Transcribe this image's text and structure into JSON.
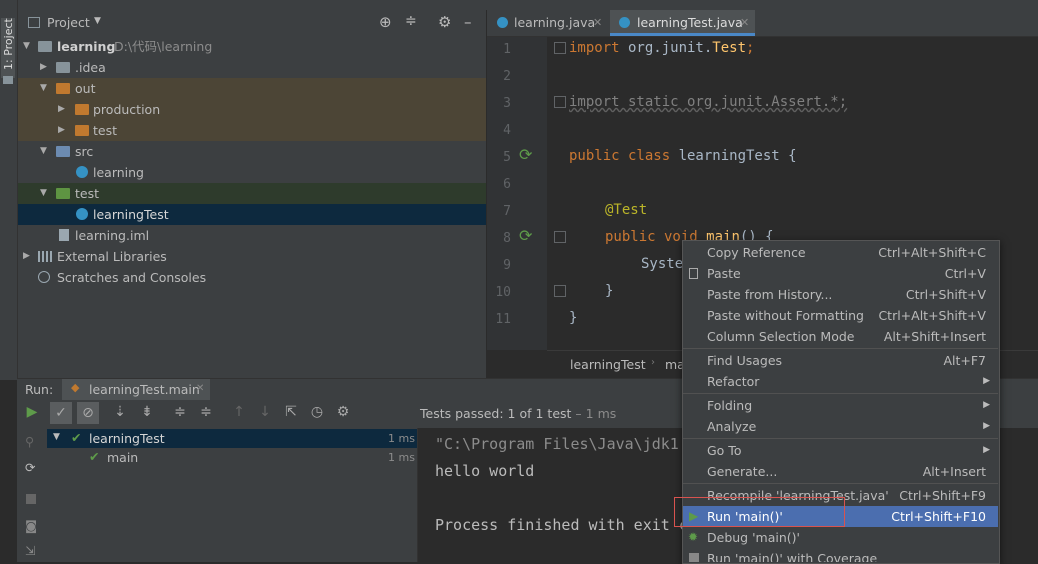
{
  "left_strip": {
    "label": "1: Project"
  },
  "project": {
    "header": "Project",
    "tree": [
      {
        "label": "learning",
        "path": "D:\\代码\\learning"
      },
      {
        "label": ".idea"
      },
      {
        "label": "out"
      },
      {
        "label": "production"
      },
      {
        "label": "test"
      },
      {
        "label": "src"
      },
      {
        "label": "learning"
      },
      {
        "label": "test"
      },
      {
        "label": "learningTest"
      },
      {
        "label": "learning.iml"
      },
      {
        "label": "External Libraries"
      },
      {
        "label": "Scratches and Consoles"
      }
    ]
  },
  "editor": {
    "tabs": [
      {
        "label": "learning.java"
      },
      {
        "label": "learningTest.java"
      }
    ],
    "line_numbers": [
      "1",
      "2",
      "3",
      "4",
      "5",
      "6",
      "7",
      "8",
      "9",
      "10",
      "11"
    ],
    "breadcrumb": [
      "learningTest",
      "mai"
    ],
    "code": {
      "l1a": "import",
      "l1b": " org.junit.",
      "l1c": "Test",
      "l1d": ";",
      "l3": "import static org.junit.Assert.*;",
      "l5a": "public class ",
      "l5b": "learningTest {",
      "l7": "@Test",
      "l8a": "public void ",
      "l8b": "main",
      "l8c": "() {",
      "l9": "Syste",
      "l10": "}",
      "l11": "}"
    }
  },
  "run": {
    "label": "Run:",
    "tab": "learningTest.main",
    "status_prefix": "Tests passed:",
    "status_count": "1",
    "status_suffix": "of 1 test",
    "status_time": "– 1 ms",
    "tests": [
      {
        "name": "learningTest",
        "time": "1 ms"
      },
      {
        "name": "main",
        "time": "1 ms"
      }
    ],
    "console": [
      "\"C:\\Program Files\\Java\\jdk1.",
      "hello world",
      "",
      "Process finished with exit c"
    ]
  },
  "context_menu": {
    "items": [
      {
        "label": "Copy Reference",
        "shortcut": "Ctrl+Alt+Shift+C"
      },
      {
        "label": "Paste",
        "shortcut": "Ctrl+V"
      },
      {
        "label": "Paste from History...",
        "shortcut": "Ctrl+Shift+V"
      },
      {
        "label": "Paste without Formatting",
        "shortcut": "Ctrl+Alt+Shift+V"
      },
      {
        "label": "Column Selection Mode",
        "shortcut": "Alt+Shift+Insert"
      },
      {
        "label": "Find Usages",
        "shortcut": "Alt+F7"
      },
      {
        "label": "Refactor",
        "shortcut": ""
      },
      {
        "label": "Folding",
        "shortcut": ""
      },
      {
        "label": "Analyze",
        "shortcut": ""
      },
      {
        "label": "Go To",
        "shortcut": ""
      },
      {
        "label": "Generate...",
        "shortcut": "Alt+Insert"
      },
      {
        "label": "Recompile 'learningTest.java'",
        "shortcut": "Ctrl+Shift+F9"
      },
      {
        "label": "Run 'main()'",
        "shortcut": "Ctrl+Shift+F10"
      },
      {
        "label": "Debug 'main()'",
        "shortcut": ""
      },
      {
        "label": "Run 'main()' with Coverage",
        "shortcut": ""
      }
    ]
  },
  "colors": {
    "accent": "#4b6eaf",
    "highlight_box": "#d9534f",
    "pass": "#5e9b4a"
  }
}
